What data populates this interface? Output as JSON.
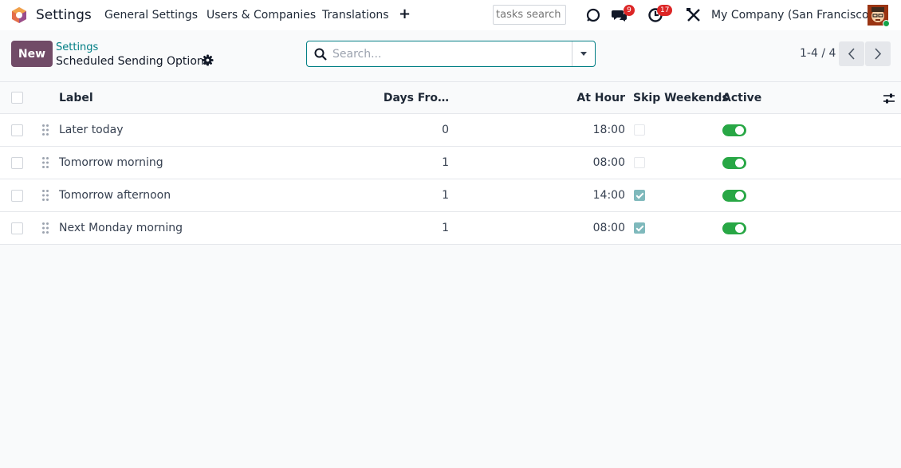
{
  "navbar": {
    "app_name": "Settings",
    "menu": [
      "General Settings",
      "Users & Companies",
      "Translations"
    ],
    "plus_label": "+",
    "tasks_search_placeholder": "tasks search",
    "messages_count": "9",
    "activities_count": "17",
    "company": "My Company (San Francisco)",
    "icons": [
      "odoo-logo-icon",
      "bug-icon",
      "chat-icon",
      "clock-icon",
      "tools-icon"
    ]
  },
  "control_panel": {
    "new_label": "New",
    "breadcrumb_parent": "Settings",
    "breadcrumb_current": "Scheduled Sending Options",
    "search_placeholder": "Search...",
    "pager": "1-4 / 4"
  },
  "table": {
    "headers": {
      "label": "Label",
      "days": "Days Fro…",
      "hour": "At Hour",
      "skip": "Skip Weekends",
      "active": "Active"
    },
    "rows": [
      {
        "label": "Later today",
        "days": "0",
        "hour": "18:00",
        "skip_weekends": false,
        "active": true
      },
      {
        "label": "Tomorrow morning",
        "days": "1",
        "hour": "08:00",
        "skip_weekends": false,
        "active": true
      },
      {
        "label": "Tomorrow afternoon",
        "days": "1",
        "hour": "14:00",
        "skip_weekends": true,
        "active": true
      },
      {
        "label": "Next Monday morning",
        "days": "1",
        "hour": "08:00",
        "skip_weekends": true,
        "active": true
      }
    ]
  },
  "colors": {
    "brand": "#714b67",
    "accent": "#017e84",
    "toggle_on": "#28a745",
    "badge": "#dc2626"
  }
}
